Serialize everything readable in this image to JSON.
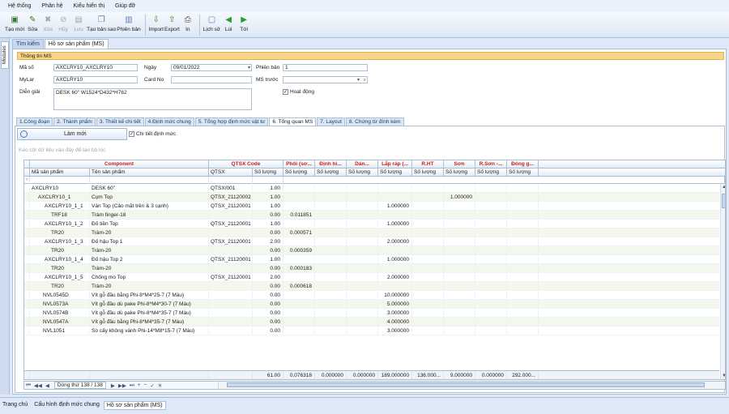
{
  "menu": [
    "Hệ thống",
    "Phân hệ",
    "Kiểu hiển thị",
    "Giúp đỡ"
  ],
  "toolbar": [
    {
      "label": "Tạo mới",
      "icon": "new-icon",
      "enabled": true
    },
    {
      "label": "Sửa",
      "icon": "edit-icon",
      "enabled": true
    },
    {
      "label": "Xóa",
      "icon": "delete-icon",
      "enabled": false
    },
    {
      "label": "Hủy",
      "icon": "cancel-icon",
      "enabled": false
    },
    {
      "label": "Lưu",
      "icon": "save-icon",
      "enabled": false
    },
    {
      "label": "Tạo bản sao",
      "icon": "copy-icon",
      "enabled": true
    },
    {
      "label": "Phiên bản",
      "icon": "version-icon",
      "enabled": true
    },
    {
      "label": "Import",
      "icon": "import-icon",
      "enabled": true
    },
    {
      "label": "Export",
      "icon": "export-icon",
      "enabled": true
    },
    {
      "label": "In",
      "icon": "print-icon",
      "enabled": true
    },
    {
      "label": "Lịch sử",
      "icon": "history-icon",
      "enabled": true
    },
    {
      "label": "Lùi",
      "icon": "back-icon",
      "enabled": true
    },
    {
      "label": "Tới",
      "icon": "forward-icon",
      "enabled": true
    }
  ],
  "side_tab": "Modules",
  "doc_tabs": [
    "Tìm kiếm",
    "Hồ sơ sản phẩm (MS)"
  ],
  "info": {
    "group_title": "Thông tin MS",
    "ma_so_label": "Mã số",
    "ma_so": "AXCLRY10_AXCLRY10",
    "ngay_label": "Ngày",
    "ngay": "09/01/2022",
    "phien_ban_label": "Phiên bản",
    "phien_ban": "1",
    "mylar_label": "MyLar",
    "mylar": "AXCLRY10",
    "card_no_label": "Card No",
    "card_no": "",
    "ms_truoc_label": "MS trước",
    "ms_truoc": "",
    "dien_giai_label": "Diễn giải",
    "dien_giai": "DESK 60\" W1524*D432*H762",
    "hoat_dong_label": "Hoạt động"
  },
  "sub_tabs": [
    "1.Công đoạn",
    "2. Thành phẩm",
    "3. Thiết kế chi tiết",
    "4.Định mức chung",
    "5. Tổng hợp định mức vật tư",
    "6. Tổng quan MS",
    "7. Layout",
    "8. Chứng từ đính kèm"
  ],
  "panel": {
    "lam_moi": "Làm mới",
    "chi_tiet": "Chi tiết định mức",
    "hint": "Kéo cột dữ liệu vào đây để tạo bộ lọc"
  },
  "grid": {
    "groups": [
      "Component",
      "QTSX Code",
      "Phôi (sơ...",
      "Định hì...",
      "Dán...",
      "Lắp ráp (...",
      "R.HT",
      "Sơn",
      "R.Sơn -...",
      "Đóng g..."
    ],
    "headers": [
      "Mã sản phẩm",
      "Tên sản phẩm",
      "QTSX",
      "Số lượng",
      "Số lượng",
      "Số lượng",
      "Số lượng",
      "Số lượng",
      "Số lượng",
      "Số lượng",
      "Số lượng",
      "Số lượng"
    ],
    "rows": [
      [
        "AXCLRY10",
        "DESK 60\"",
        "QTSX/001",
        "1.00",
        "",
        "",
        "",
        "",
        "",
        "",
        "",
        ""
      ],
      [
        "AXCLRY10_1",
        "Cụm Top",
        "QTSX_21120002",
        "1.00",
        "",
        "",
        "",
        "",
        "",
        "1.000000",
        "",
        ""
      ],
      [
        "AXCLRY10_1_1",
        "Ván Top (Cảo mặt trên & 3 cạnh)",
        "QTSX_21120001",
        "1.00",
        "",
        "",
        "",
        "1.000000",
        "",
        "",
        "",
        ""
      ],
      [
        "TRF18",
        "Tràm finger-18",
        "",
        "0.00",
        "0.011851",
        "",
        "",
        "",
        "",
        "",
        "",
        ""
      ],
      [
        "AXCLRY10_1_2",
        "Đố tiền Top",
        "QTSX_21120001",
        "1.00",
        "",
        "",
        "",
        "1.000000",
        "",
        "",
        "",
        ""
      ],
      [
        "TR20",
        "Tràm-20",
        "",
        "0.00",
        "0.000571",
        "",
        "",
        "",
        "",
        "",
        "",
        ""
      ],
      [
        "AXCLRY10_1_3",
        "Đố hậu Top 1",
        "QTSX_21120001",
        "2.00",
        "",
        "",
        "",
        "2.000000",
        "",
        "",
        "",
        ""
      ],
      [
        "TR20",
        "Tràm-20",
        "",
        "0.00",
        "0.000359",
        "",
        "",
        "",
        "",
        "",
        "",
        ""
      ],
      [
        "AXCLRY10_1_4",
        "Đố hậu Top 2",
        "QTSX_21120001",
        "1.00",
        "",
        "",
        "",
        "1.000000",
        "",
        "",
        "",
        ""
      ],
      [
        "TR20",
        "Tràm-20",
        "",
        "0.00",
        "0.000183",
        "",
        "",
        "",
        "",
        "",
        "",
        ""
      ],
      [
        "AXCLRY10_1_5",
        "Chống mo Top",
        "QTSX_21120001",
        "2.00",
        "",
        "",
        "",
        "2.000000",
        "",
        "",
        "",
        ""
      ],
      [
        "TR20",
        "Tràm-20",
        "",
        "0.00",
        "0.000618",
        "",
        "",
        "",
        "",
        "",
        "",
        ""
      ],
      [
        "NVL0545D",
        "Vít gỗ đầu bằng Phi-8*M4*25-7 (7 Màu)",
        "",
        "0.00",
        "",
        "",
        "",
        "10.000000",
        "",
        "",
        "",
        ""
      ],
      [
        "NVL0573A",
        "Vít gỗ đầu dù pake Phi-8*M4*30-7 (7 Màu)",
        "",
        "0.00",
        "",
        "",
        "",
        "5.000000",
        "",
        "",
        "",
        ""
      ],
      [
        "NVL0574B",
        "Vít gỗ đầu dù pake Phi-8*M4*35-7 (7 Màu)",
        "",
        "0.00",
        "",
        "",
        "",
        "3.000000",
        "",
        "",
        "",
        ""
      ],
      [
        "NVL0547A",
        "Vít gỗ đầu bằng Phi-8*M4*35-7 (7 Màu)",
        "",
        "0.00",
        "",
        "",
        "",
        "4.000000",
        "",
        "",
        "",
        ""
      ],
      [
        "NVL1051",
        "Sò cấy không vành Phi-14*M8*15-7 (7 Màu)",
        "",
        "0.00",
        "",
        "",
        "",
        "3.000000",
        "",
        "",
        "",
        ""
      ]
    ],
    "footer": [
      "",
      "",
      "",
      "61.00",
      "0.076318",
      "0.000000",
      "0.000000",
      "189.000000",
      "136.000...",
      "9.000000",
      "0.000000",
      "292.000..."
    ]
  },
  "navbar": {
    "position": "Dòng thứ 138 / 138"
  },
  "status_tabs": [
    "Trang chủ",
    "Cấu hình định mức chung",
    "Hồ sơ sản phẩm (MS)"
  ]
}
